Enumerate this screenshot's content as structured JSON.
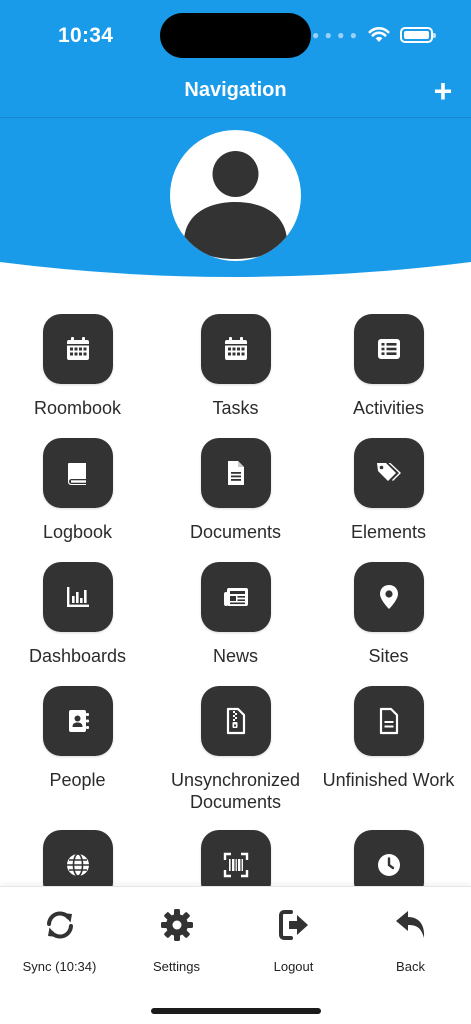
{
  "status_bar": {
    "time": "10:34"
  },
  "nav": {
    "title": "Navigation",
    "add_label": "+"
  },
  "colors": {
    "header": "#1a9bea",
    "tile": "#333333",
    "text": "#2b2b2b"
  },
  "menu": {
    "items": [
      {
        "label": "Roombook",
        "icon": "calendar-icon"
      },
      {
        "label": "Tasks",
        "icon": "calendar-icon"
      },
      {
        "label": "Activities",
        "icon": "list-icon"
      },
      {
        "label": "Logbook",
        "icon": "book-icon"
      },
      {
        "label": "Documents",
        "icon": "file-text-icon"
      },
      {
        "label": "Elements",
        "icon": "tags-icon"
      },
      {
        "label": "Dashboards",
        "icon": "bar-chart-icon"
      },
      {
        "label": "News",
        "icon": "newspaper-icon"
      },
      {
        "label": "Sites",
        "icon": "map-marker-icon"
      },
      {
        "label": "People",
        "icon": "address-book-icon"
      },
      {
        "label": "Unsynchronized Documents",
        "icon": "file-archive-icon"
      },
      {
        "label": "Unfinished Work",
        "icon": "file-lines-icon"
      },
      {
        "label": "",
        "icon": "globe-icon"
      },
      {
        "label": "",
        "icon": "barcode-scan-icon"
      },
      {
        "label": "",
        "icon": "clock-icon"
      }
    ]
  },
  "tabbar": {
    "sync": "Sync (10:34)",
    "settings": "Settings",
    "logout": "Logout",
    "back": "Back"
  }
}
